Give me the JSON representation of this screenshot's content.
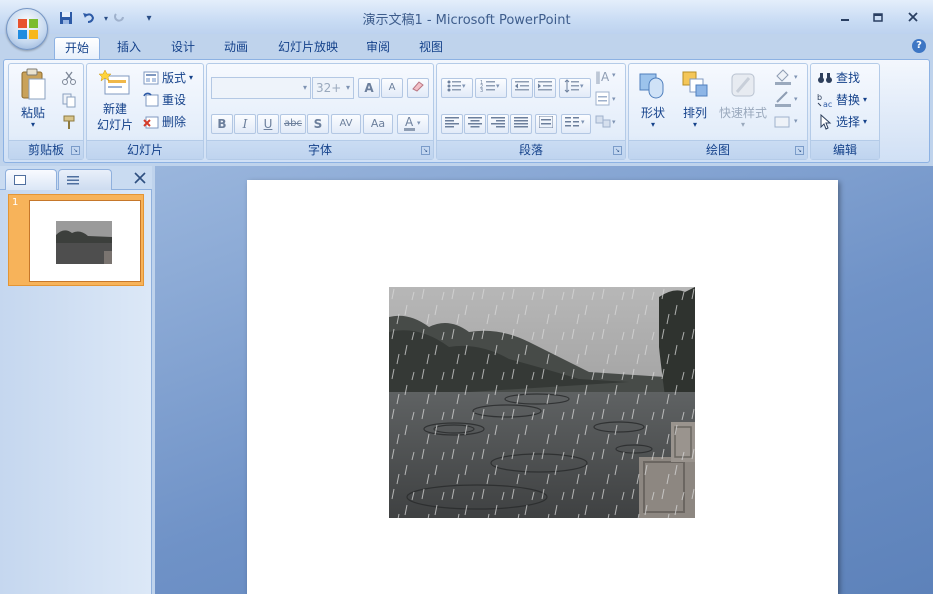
{
  "window": {
    "title": "演示文稿1 - Microsoft PowerPoint"
  },
  "qat": {
    "customize": "▾"
  },
  "tabs": [
    "开始",
    "插入",
    "设计",
    "动画",
    "幻灯片放映",
    "审阅",
    "视图"
  ],
  "ribbon": {
    "clipboard": {
      "label": "剪贴板",
      "paste": "粘贴",
      "paste_arrow": "▾"
    },
    "slides": {
      "label": "幻灯片",
      "new_slide_1": "新建",
      "new_slide_2": "幻灯片",
      "layout": "版式",
      "reset": "重设",
      "delete": "删除"
    },
    "font": {
      "label": "字体",
      "font_size": "32+",
      "bold": "B",
      "italic": "I",
      "underline": "U",
      "strikethrough": "abc",
      "shadow": "S",
      "char_spacing": "AV",
      "change_case": "Aa",
      "grow": "A",
      "shrink": "A"
    },
    "paragraph": {
      "label": "段落"
    },
    "drawing": {
      "label": "绘图",
      "shapes": "形状",
      "arrange": "排列",
      "quick_styles": "快速样式"
    },
    "editing": {
      "label": "编辑",
      "find": "查找",
      "replace": "替换",
      "select": "选择"
    }
  },
  "slide_pane": {
    "slide_number": "1"
  },
  "colors": {
    "accent": "#15428b",
    "selection": "#f7b35a"
  }
}
